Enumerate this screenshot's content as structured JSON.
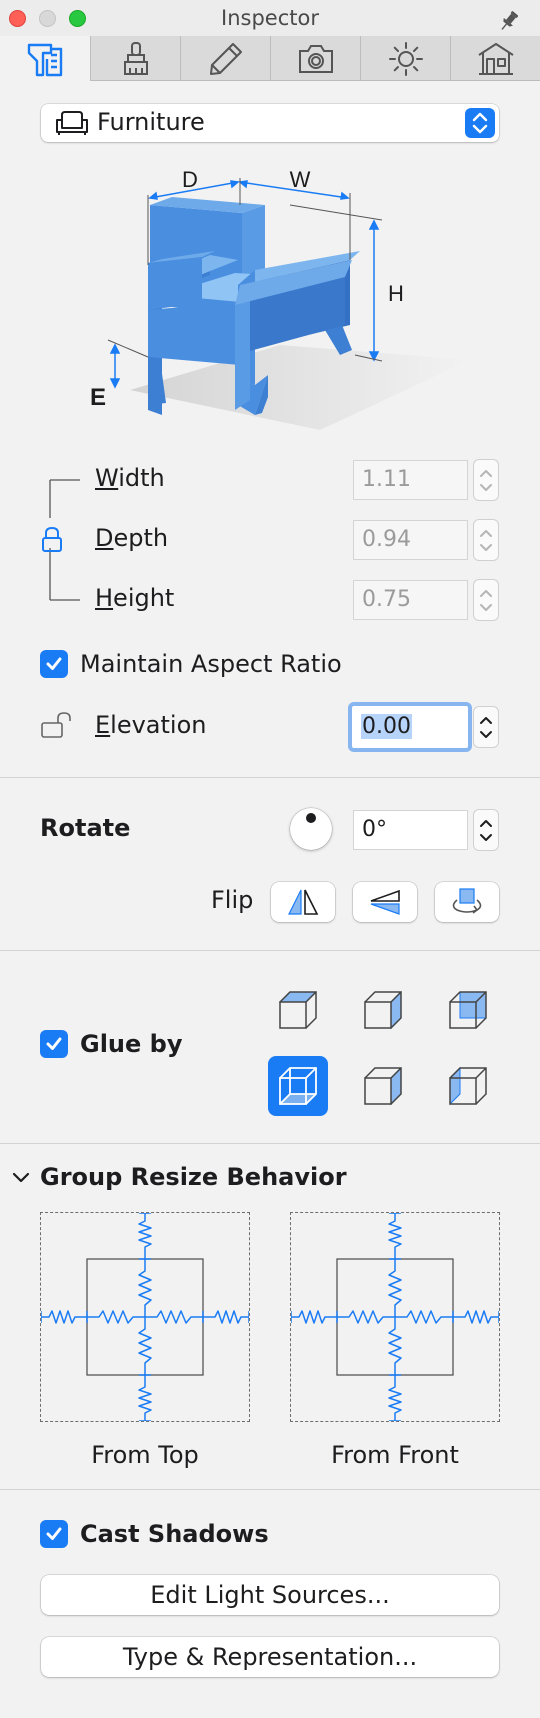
{
  "window": {
    "title": "Inspector"
  },
  "tabs": [
    {
      "icon": "caliper-ruler-icon",
      "active": true
    },
    {
      "icon": "paint-brush-icon",
      "active": false
    },
    {
      "icon": "pencil-icon",
      "active": false
    },
    {
      "icon": "camera-icon",
      "active": false
    },
    {
      "icon": "sun-icon",
      "active": false
    },
    {
      "icon": "house-icon",
      "active": false
    }
  ],
  "category": {
    "label": "Furniture",
    "icon": "armchair-icon"
  },
  "diagram": {
    "d_label": "D",
    "w_label": "W",
    "h_label": "H",
    "e_label": "E"
  },
  "dimensions": {
    "width": {
      "label_first": "W",
      "label_rest": "idth",
      "value": "1.11"
    },
    "depth": {
      "label_first": "D",
      "label_rest": "epth",
      "value": "0.94"
    },
    "height": {
      "label_first": "H",
      "label_rest": "eight",
      "value": "0.75"
    }
  },
  "maintain_aspect": {
    "label": "Maintain Aspect Ratio",
    "checked": true
  },
  "elevation": {
    "label_first": "E",
    "label_rest": "levation",
    "value": "0.00"
  },
  "rotate": {
    "title": "Rotate",
    "value": "0°"
  },
  "flip": {
    "label": "Flip"
  },
  "glue": {
    "label": "Glue by",
    "checked": true,
    "selected_index": 3
  },
  "group_resize": {
    "title": "Group Resize Behavior",
    "from_top": "From Top",
    "from_front": "From Front"
  },
  "cast_shadows": {
    "label": "Cast Shadows",
    "checked": true
  },
  "buttons": {
    "edit_light": "Edit Light Sources...",
    "type_repr": "Type & Representation..."
  },
  "colors": {
    "accent": "#1a7cf5",
    "chair": "#4a8ee0",
    "spring": "#1a7cf5"
  }
}
